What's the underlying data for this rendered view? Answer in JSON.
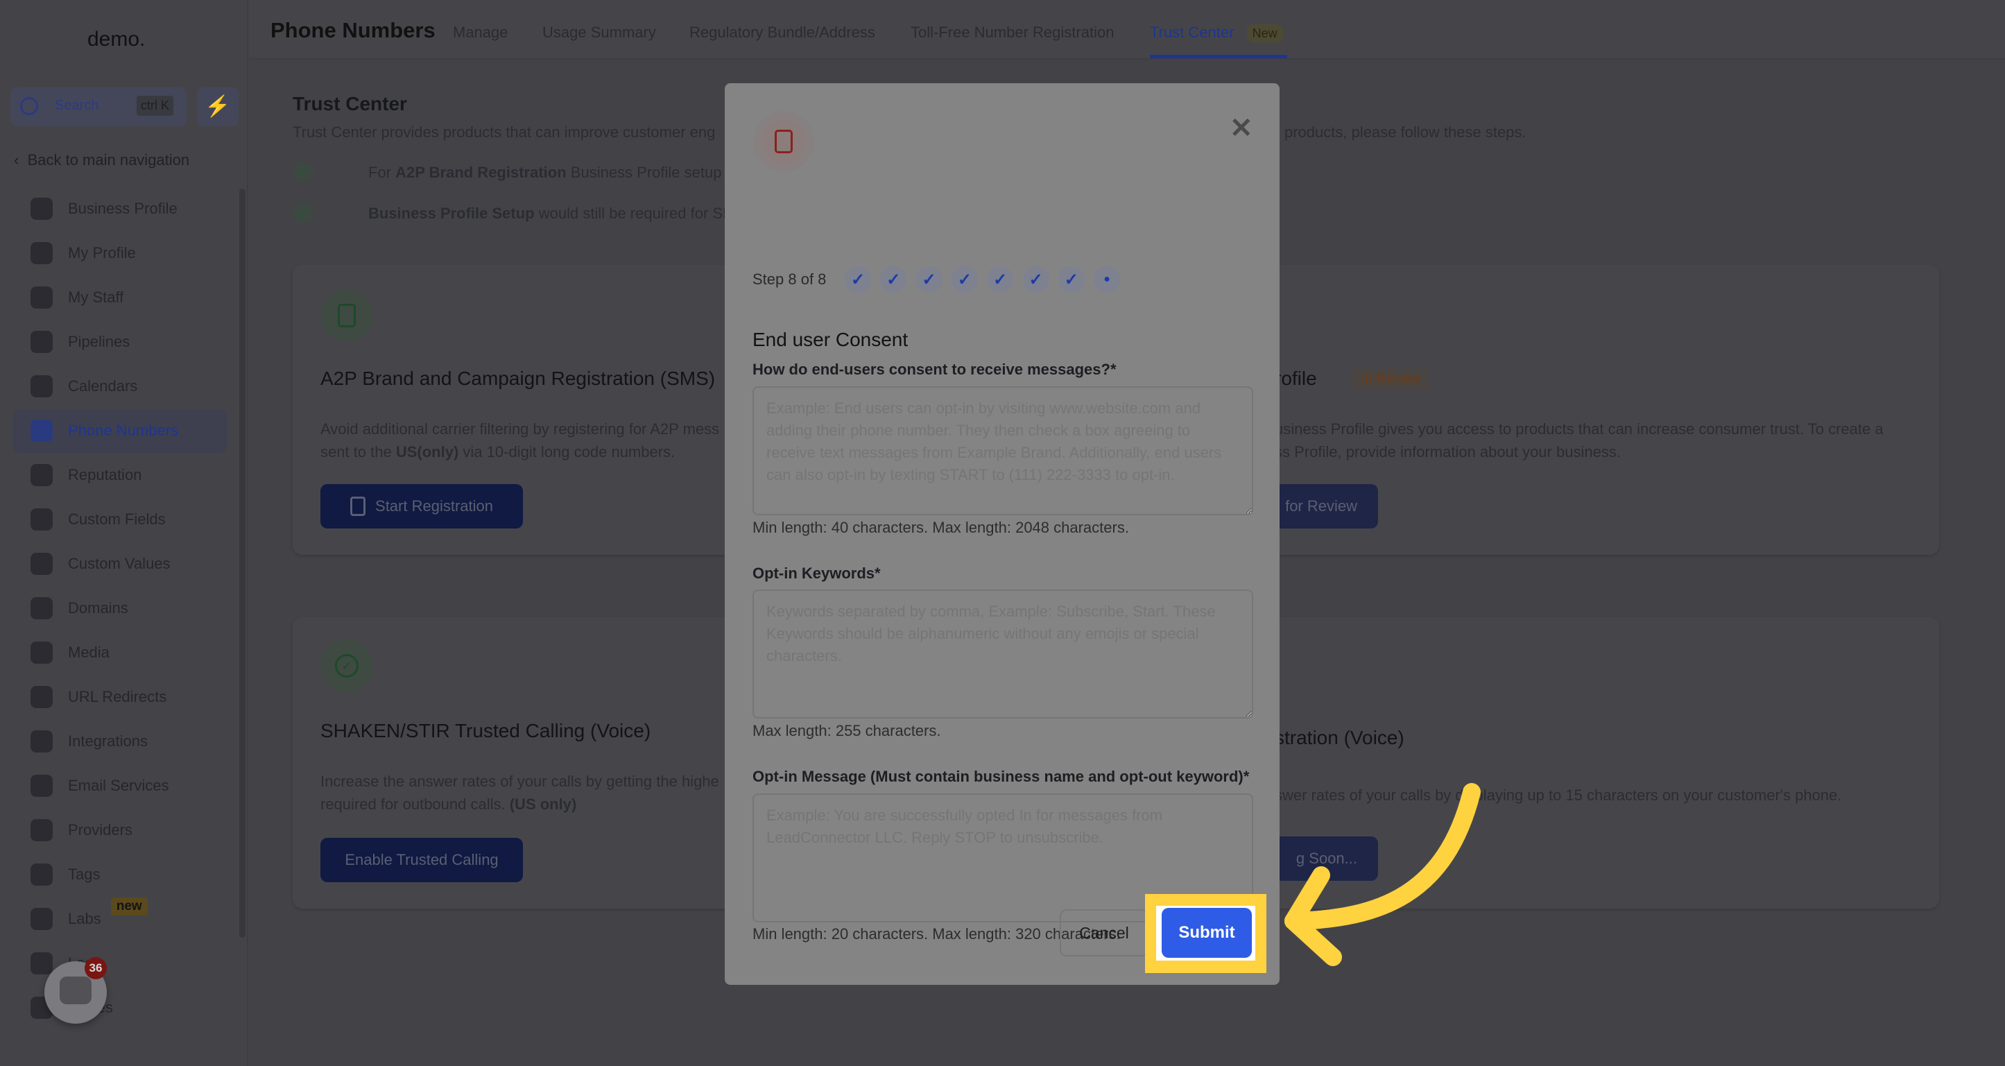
{
  "sidebar": {
    "logo": "demo.",
    "search_label": "Search",
    "search_shortcut": "ctrl K",
    "back_label": "Back to main navigation",
    "items": [
      {
        "label": "Business Profile",
        "icon": "briefcase-icon"
      },
      {
        "label": "My Profile",
        "icon": "user-circle-icon"
      },
      {
        "label": "My Staff",
        "icon": "user-icon"
      },
      {
        "label": "Pipelines",
        "icon": "funnel-icon"
      },
      {
        "label": "Calendars",
        "icon": "calendar-icon"
      },
      {
        "label": "Phone Numbers",
        "icon": "phone-icon",
        "active": true
      },
      {
        "label": "Reputation",
        "icon": "star-icon"
      },
      {
        "label": "Custom Fields",
        "icon": "field-icon"
      },
      {
        "label": "Custom Values",
        "icon": "diamond-icon"
      },
      {
        "label": "Domains",
        "icon": "globe-icon"
      },
      {
        "label": "Media",
        "icon": "video-icon"
      },
      {
        "label": "URL Redirects",
        "icon": "redirect-icon"
      },
      {
        "label": "Integrations",
        "icon": "integrations-icon"
      },
      {
        "label": "Email Services",
        "icon": "mail-icon"
      },
      {
        "label": "Providers",
        "icon": "clipboard-icon"
      },
      {
        "label": "Tags",
        "icon": "tag-icon"
      },
      {
        "label": "Labs",
        "icon": "flask-icon",
        "badge": "new"
      },
      {
        "label": "Logs",
        "icon": "chart-icon"
      },
      {
        "label": "panies",
        "icon": "building-icon"
      }
    ],
    "chat_badge": "36"
  },
  "header": {
    "title": "Phone Numbers",
    "tabs": [
      {
        "label": "Manage"
      },
      {
        "label": "Usage Summary"
      },
      {
        "label": "Regulatory Bundle/Address"
      },
      {
        "label": "Toll-Free Number Registration"
      },
      {
        "label": "Trust Center",
        "active": true,
        "badge": "New"
      }
    ]
  },
  "main": {
    "title": "Trust Center",
    "desc_left": "Trust Center provides products that can improve customer eng",
    "desc_right": "products, please follow these steps.",
    "check1_bold": "A2P Brand Registration",
    "check1_pre": "For ",
    "check1_post": " Business Profile setup is",
    "check2_bold": "Business Profile Setup",
    "check2_post": " would still be required for SH",
    "a2p": {
      "title": "A2P Brand and Campaign Registration (SMS)",
      "desc1": "Avoid additional carrier filtering by registering for A2P mess",
      "desc2_pre": "sent to the ",
      "desc2_bold": "US(only)",
      "desc2_post": " via 10-digit long code numbers.",
      "button": "Start Registration"
    },
    "bp": {
      "title": "rofile",
      "badge": "In-Review",
      "desc1": "usiness Profile gives you access to products that can increase consumer trust. To create a",
      "desc2": "ss Profile, provide information about your business.",
      "button": "for Review"
    },
    "shaken": {
      "title": "SHAKEN/STIR Trusted Calling (Voice)",
      "desc1": "Increase the answer rates of your calls by getting the highe",
      "desc2_pre": "required for outbound calls. ",
      "desc2_bold": "(US only)",
      "button": "Enable Trusted Calling"
    },
    "cnam": {
      "title": "stration (Voice)",
      "desc1": "swer rates of your calls by displaying up to 15 characters on your customer's phone.",
      "button": "g Soon..."
    }
  },
  "modal": {
    "step_text": "Step 8 of 8",
    "steps_total": 8,
    "steps_completed": 7,
    "heading": "End user Consent",
    "fields": [
      {
        "label": "How do end-users consent to receive messages?*",
        "placeholder": "Example: End users can opt-in by visiting www.website.com and adding their phone number. They then check a box agreeing to receive text messages from Example Brand. Additionally, end users can also opt-in by texting START to (111) 222-3333 to opt-in.",
        "value": "",
        "help": "Min length: 40 characters. Max length: 2048 characters."
      },
      {
        "label": "Opt-in Keywords*",
        "placeholder": "Keywords separated by comma, Example: Subscribe, Start. These Keywords should be alphanumeric without any emojis or special characters.",
        "value": "",
        "help": "Max length: 255 characters."
      },
      {
        "label": "Opt-in Message (Must contain business name and opt-out keyword)*",
        "placeholder": "Example: You are successfully opted In for messages from LeadConnector LLC. Reply STOP to unsubscribe.",
        "value": "",
        "help": "Min length: 20 characters. Max length: 320 characters."
      }
    ],
    "cancel": "Cancel",
    "submit": "Submit"
  },
  "colors": {
    "accent": "#2f5ce6",
    "highlight": "#ffd23f",
    "overlay_bg": "#434347",
    "modal_bg": "#848484"
  }
}
